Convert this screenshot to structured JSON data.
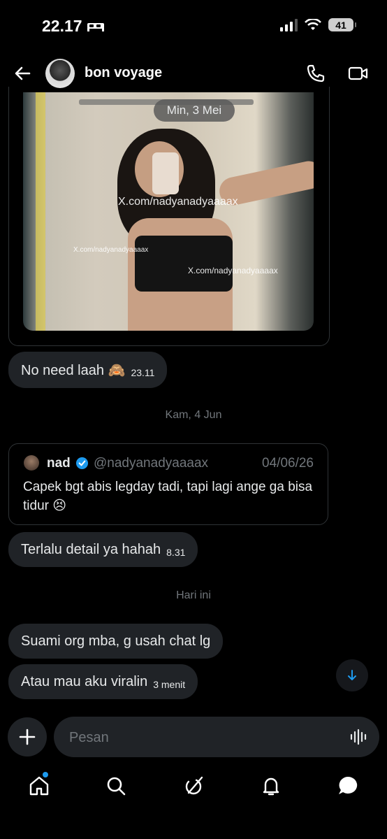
{
  "status_bar": {
    "time": "22.17",
    "battery": "41"
  },
  "header": {
    "title": "bon voyage"
  },
  "photo_message": {
    "date_pill": "Min, 3 Mei",
    "watermarks": [
      "X.com/nadyanadyaaaax",
      "X.com/nadyanadyaaaax",
      "X.com/nadyanadyaaaax"
    ]
  },
  "messages": [
    {
      "text": "No need laah 🙈",
      "time": "23.11"
    },
    {
      "text": "Terlalu detail ya hahah",
      "time": "8.31"
    },
    {
      "text": "Suami org mba, g usah chat lg",
      "time": ""
    },
    {
      "text": "Atau mau aku viralin",
      "time": "3 menit"
    }
  ],
  "separators": {
    "jun": "Kam, 4 Jun",
    "today": "Hari ini"
  },
  "quoted_post": {
    "name": "nad",
    "handle": "@nadyanadyaaaax",
    "date": "04/06/26",
    "text": "Capek bgt abis legday tadi, tapi lagi ange ga bisa tidur 😣"
  },
  "composer": {
    "placeholder": "Pesan"
  },
  "icons": {
    "back": "arrow-left-icon",
    "call": "phone-icon",
    "video": "video-icon",
    "scroll": "arrow-down-icon",
    "add": "plus-icon",
    "voice": "waveform-icon",
    "nav": [
      "home-icon",
      "search-icon",
      "grok-icon",
      "bell-icon",
      "messages-icon"
    ]
  },
  "colors": {
    "accent": "#1d9bf0",
    "bubble": "#202327",
    "muted": "#71767b",
    "background": "#000000"
  }
}
